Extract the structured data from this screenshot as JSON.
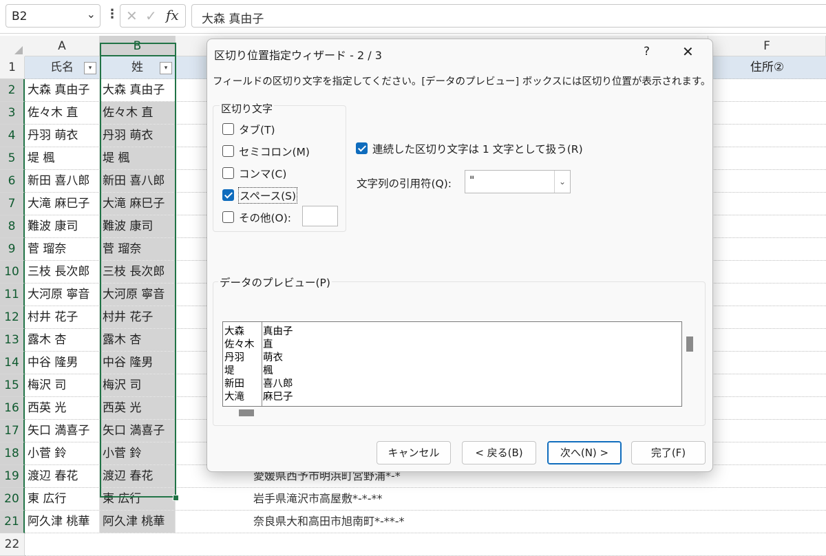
{
  "formula_bar": {
    "namebox": "B2",
    "namebox_arrow": "⌄",
    "dots": "⋮",
    "cancel_glyph": "✕",
    "enter_glyph": "✓",
    "fx": "fx",
    "content": "大森 真由子"
  },
  "columns": [
    "A",
    "B",
    "F"
  ],
  "row_numbers": [
    "1",
    "2",
    "3",
    "4",
    "5",
    "6",
    "7",
    "8",
    "9",
    "10",
    "11",
    "12",
    "13",
    "14",
    "15",
    "16",
    "17",
    "18",
    "19",
    "20",
    "21",
    "22"
  ],
  "header_row": {
    "a": "氏名",
    "b": "姓",
    "f": "住所②",
    "filter_glyph": "▾"
  },
  "rows": [
    {
      "a": "大森 真由子",
      "b": "大森 真由子",
      "d": ""
    },
    {
      "a": "佐々木 直",
      "b": "佐々木 直",
      "d": ""
    },
    {
      "a": "丹羽 萌衣",
      "b": "丹羽 萌衣",
      "d": ""
    },
    {
      "a": "堤 楓",
      "b": "堤 楓",
      "d": ""
    },
    {
      "a": "新田 喜八郎",
      "b": "新田 喜八郎",
      "d": ""
    },
    {
      "a": "大滝 麻巳子",
      "b": "大滝 麻巳子",
      "d": ""
    },
    {
      "a": "難波 康司",
      "b": "難波 康司",
      "d": ""
    },
    {
      "a": "菅 瑠奈",
      "b": "菅 瑠奈",
      "d": ""
    },
    {
      "a": "三枝 長次郎",
      "b": "三枝 長次郎",
      "d": ""
    },
    {
      "a": "大河原 寧音",
      "b": "大河原 寧音",
      "d": ""
    },
    {
      "a": "村井 花子",
      "b": "村井 花子",
      "d": ""
    },
    {
      "a": "露木 杏",
      "b": "露木 杏",
      "d": ""
    },
    {
      "a": "中谷 隆男",
      "b": "中谷 隆男",
      "d": ""
    },
    {
      "a": "梅沢 司",
      "b": "梅沢 司",
      "d": ""
    },
    {
      "a": "西英 光",
      "b": "西英 光",
      "d": ""
    },
    {
      "a": "矢口 満喜子",
      "b": "矢口 満喜子",
      "d": ""
    },
    {
      "a": "小菅 鈴",
      "b": "小菅 鈴",
      "d": ""
    },
    {
      "a": "渡辺 春花",
      "b": "渡辺 春花",
      "d": "愛媛県西予市明浜町宮野浦*-*"
    },
    {
      "a": "東 広行",
      "b": "東 広行",
      "d": "岩手県滝沢市高屋敷*-*-**"
    },
    {
      "a": "阿久津 桃華",
      "b": "阿久津 桃華",
      "d": "奈良県大和高田市旭南町*-**-*"
    }
  ],
  "dialog": {
    "title": "区切り位置指定ウィザード - 2 / 3",
    "help": "?",
    "close": "✕",
    "instruction": "フィールドの区切り文字を指定してください。[データのプレビュー] ボックスには区切り位置が表示されます。",
    "delimiters_title": "区切り文字",
    "delimiters": [
      {
        "label": "タブ(T)",
        "checked": false
      },
      {
        "label": "セミコロン(M)",
        "checked": false
      },
      {
        "label": "コンマ(C)",
        "checked": false
      },
      {
        "label": "スペース(S)",
        "checked": true
      },
      {
        "label": "その他(O):",
        "checked": false
      }
    ],
    "consecutive_label": "連続した区切り文字は 1 文字として扱う(R)",
    "consecutive_checked": true,
    "quote_label": "文字列の引用符(Q):",
    "quote_value": "\"",
    "quote_arrow": "⌄",
    "preview_title": "データのプレビュー(P)",
    "preview_rows": [
      {
        "c1": "大森",
        "c2": "真由子"
      },
      {
        "c1": "佐々木",
        "c2": "直"
      },
      {
        "c1": "丹羽",
        "c2": "萌衣"
      },
      {
        "c1": "堤",
        "c2": "楓"
      },
      {
        "c1": "新田",
        "c2": "喜八郎"
      },
      {
        "c1": "大滝",
        "c2": "麻巳子"
      }
    ],
    "buttons": {
      "cancel": "キャンセル",
      "back": "< 戻る(B)",
      "next": "次へ(N) >",
      "finish": "完了(F)"
    }
  },
  "colors": {
    "accent": "#217346",
    "header_fill": "#dce6f1",
    "selection_fill": "#d4d4d4",
    "checkbox": "#0f6cbd"
  }
}
